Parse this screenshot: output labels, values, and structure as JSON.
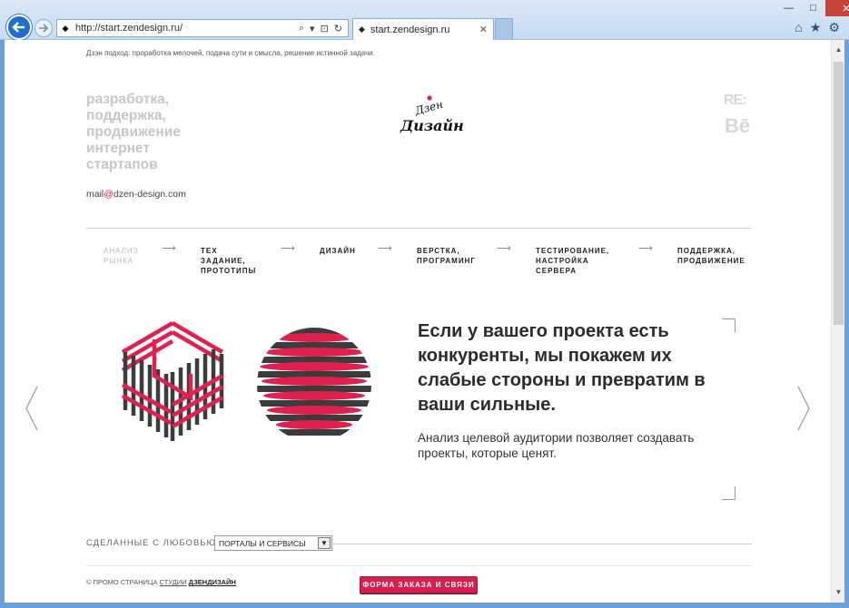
{
  "browser": {
    "url": "http://start.zendesign.ru/",
    "tab_title": "start.zendesign.ru",
    "window_controls": {
      "minimize": "—",
      "maximize": "□",
      "close": "✕"
    }
  },
  "header": {
    "tagline": "Дзэн подход: проработка мелочей, подача сути и смысла, решение истинной задачи.",
    "hero_lines": [
      "разработка,",
      "поддержка,",
      "продвижение",
      "интернет",
      "стартапов"
    ],
    "email_user": "mail",
    "email_at": "@",
    "email_domain": "dzen-design.com",
    "logo_text_top": "Дзен",
    "logo_text_bottom": "Дизайн",
    "social_re": "RE:",
    "social_be": "Bē"
  },
  "steps": [
    {
      "label_1": "АНАЛИЗ",
      "label_2": "РЫНКА",
      "label_3": ""
    },
    {
      "label_1": "ТЕХ",
      "label_2": "ЗАДАНИЕ,",
      "label_3": "ПРОТОТИПЫ"
    },
    {
      "label_1": "ДИЗАЙН",
      "label_2": "",
      "label_3": ""
    },
    {
      "label_1": "ВЕРСТКА,",
      "label_2": "ПРОГРАМИНГ",
      "label_3": ""
    },
    {
      "label_1": "ТЕСТИРОВАНИЕ,",
      "label_2": "НАСТРОЙКА",
      "label_3": "СЕРВЕРА"
    },
    {
      "label_1": "ПОДДЕРЖКА,",
      "label_2": "ПРОДВИЖЕНИЕ",
      "label_3": ""
    }
  ],
  "step_arrow": "⟶",
  "slide": {
    "heading": "Если у вашего проекта есть конкуренты, мы покажем их слабые стороны и превратим в ваши сильные.",
    "subheading": "Анализ целевой аудитории позволяет создавать проекты, которые ценят.",
    "accent_color": "#e0204f",
    "dark_color": "#3c3c3c"
  },
  "portfolio": {
    "label": "СДЕЛАННЫЕ С ЛЮБОВЬЮ",
    "select_value": "ПОРТАЛЫ И СЕРВИСЫ"
  },
  "footer": {
    "text_prefix": "© ПРОМО СТРАНИЦА ",
    "studio_link": "СТУДИИ",
    "brand_link": "ДЗЕНДИЗАЙН",
    "order_button": "ФОРМА ЗАКАЗА И СВЯЗИ"
  }
}
